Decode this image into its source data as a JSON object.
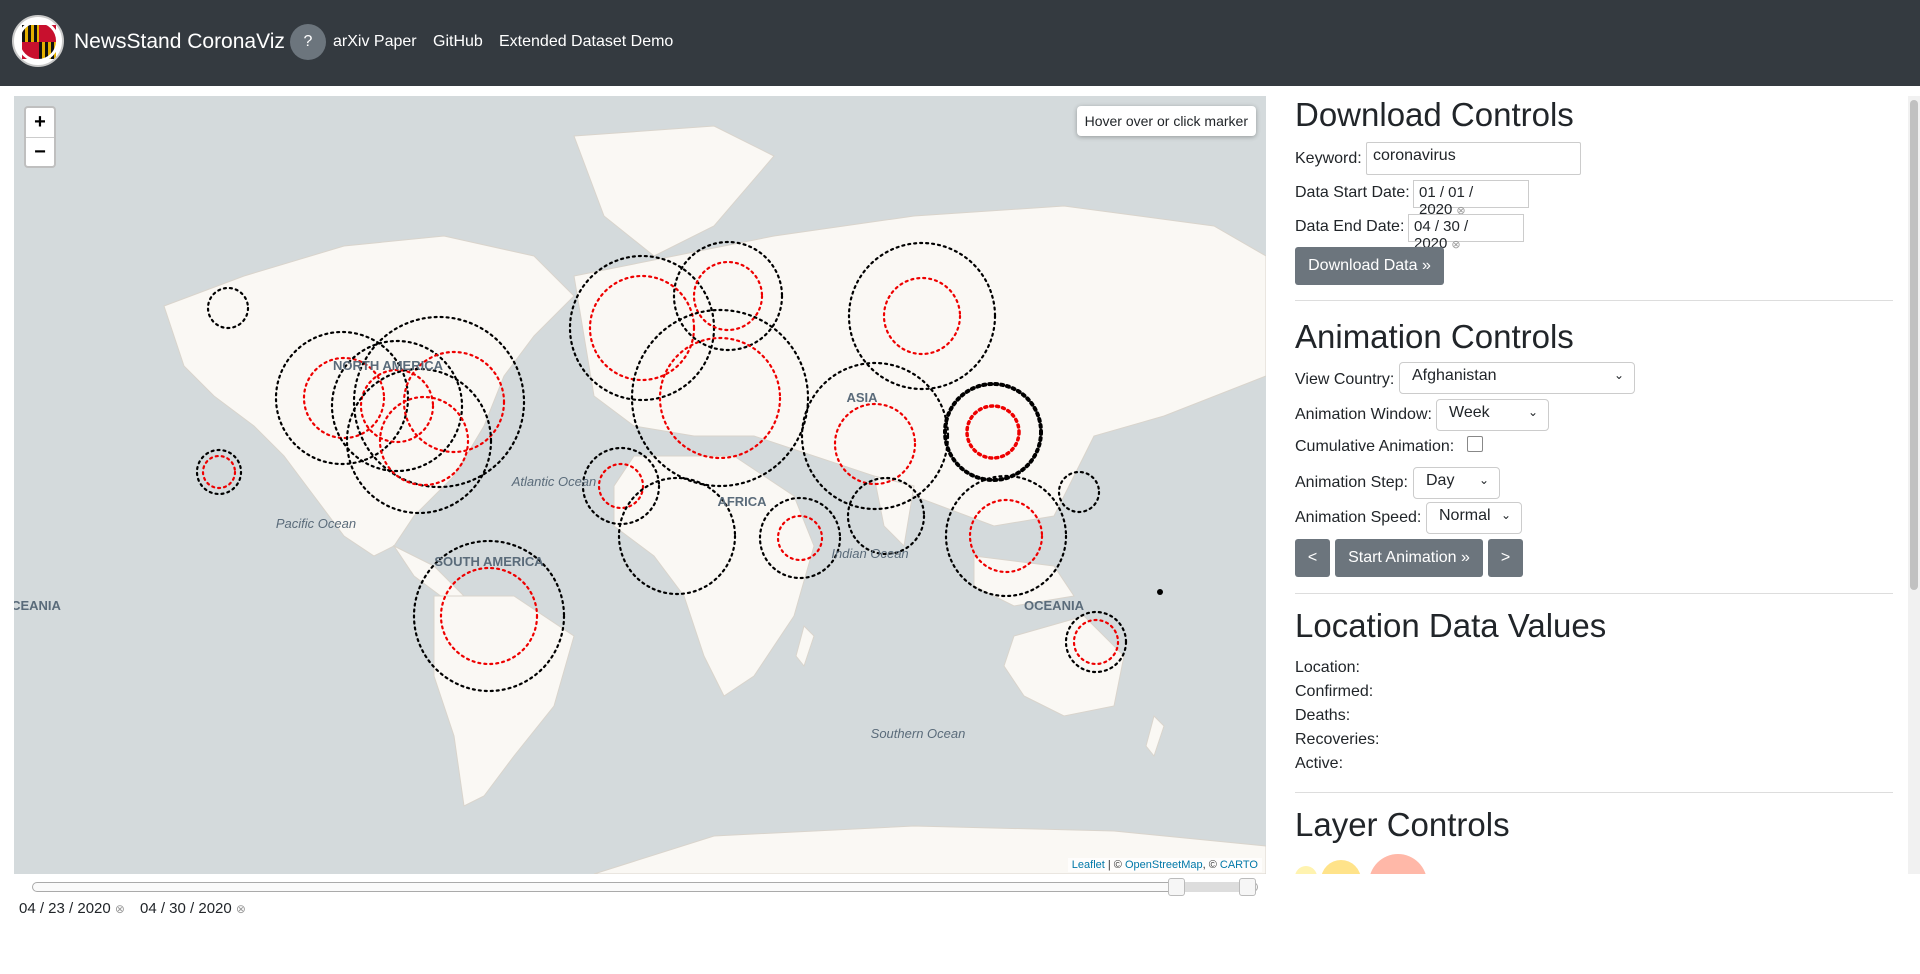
{
  "navbar": {
    "brand": "NewsStand CoronaViz",
    "help_label": "?",
    "links": [
      "arXiv Paper",
      "GitHub",
      "Extended Dataset Demo"
    ]
  },
  "map": {
    "zoom_in": "+",
    "zoom_out": "−",
    "hover_hint": "Hover over or click marker",
    "labels": {
      "north_america": "NORTH AMERICA",
      "south_america": "SOUTH AMERICA",
      "africa": "AFRICA",
      "asia": "ASIA",
      "oceania": "OCEANIA",
      "oceania_left": "CEANIA",
      "pacific": "Pacific Ocean",
      "atlantic": "Atlantic Ocean",
      "indian": "Indian Ocean",
      "southern": "Southern Ocean"
    },
    "attribution": {
      "leaflet": "Leaflet",
      "sep1": " | © ",
      "osm": "OpenStreetMap",
      "sep2": ", © ",
      "carto": "CARTO"
    },
    "colors": {
      "water": "#d4dadc",
      "land": "#faf8f4",
      "confirmed": "#000000",
      "active": "#e00000"
    }
  },
  "timeline": {
    "start_date": "04 / 23 / 2020",
    "end_date": "04 / 30 / 2020"
  },
  "download": {
    "title": "Download Controls",
    "keyword_label": "Keyword:",
    "keyword_value": "coronavirus",
    "start_label": "Data Start Date:",
    "start_value": "01 / 01 / 2020",
    "end_label": "Data End Date:",
    "end_value": "04 / 30 / 2020",
    "button": "Download Data »"
  },
  "animation": {
    "title": "Animation Controls",
    "country_label": "View Country:",
    "country_value": "Afghanistan",
    "window_label": "Animation Window:",
    "window_value": "Week",
    "cumulative_label": "Cumulative Animation:",
    "step_label": "Animation Step:",
    "step_value": "Day",
    "speed_label": "Animation Speed:",
    "speed_value": "Normal",
    "prev": "<",
    "start": "Start Animation »",
    "next": ">"
  },
  "location": {
    "title": "Location Data Values",
    "fields": [
      "Location:",
      "Confirmed:",
      "Deaths:",
      "Recoveries:",
      "Active:"
    ]
  },
  "layers": {
    "title": "Layer Controls"
  }
}
